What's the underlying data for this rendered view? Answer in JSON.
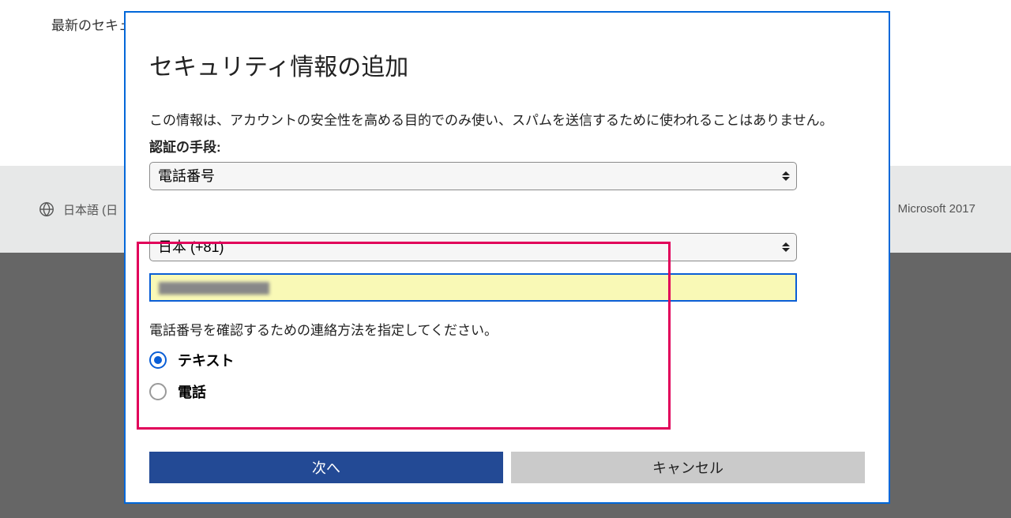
{
  "background": {
    "top_text": "最新のセキュ",
    "language_label": "日本語 (日",
    "copyright": "Microsoft 2017"
  },
  "dialog": {
    "title": "セキュリティ情報の追加",
    "description": "この情報は、アカウントの安全性を高める目的でのみ使い、スパムを送信するために使われることはありません。",
    "auth_method_label": "認証の手段:",
    "auth_method_value": "電話番号",
    "country_value": "日本 (+81)",
    "phone_input_value": "",
    "verify_text": "電話番号を確認するための連絡方法を指定してください。",
    "radio_text_label": "テキスト",
    "radio_call_label": "電話",
    "radio_selected": "text",
    "next_button": "次へ",
    "cancel_button": "キャンセル"
  }
}
